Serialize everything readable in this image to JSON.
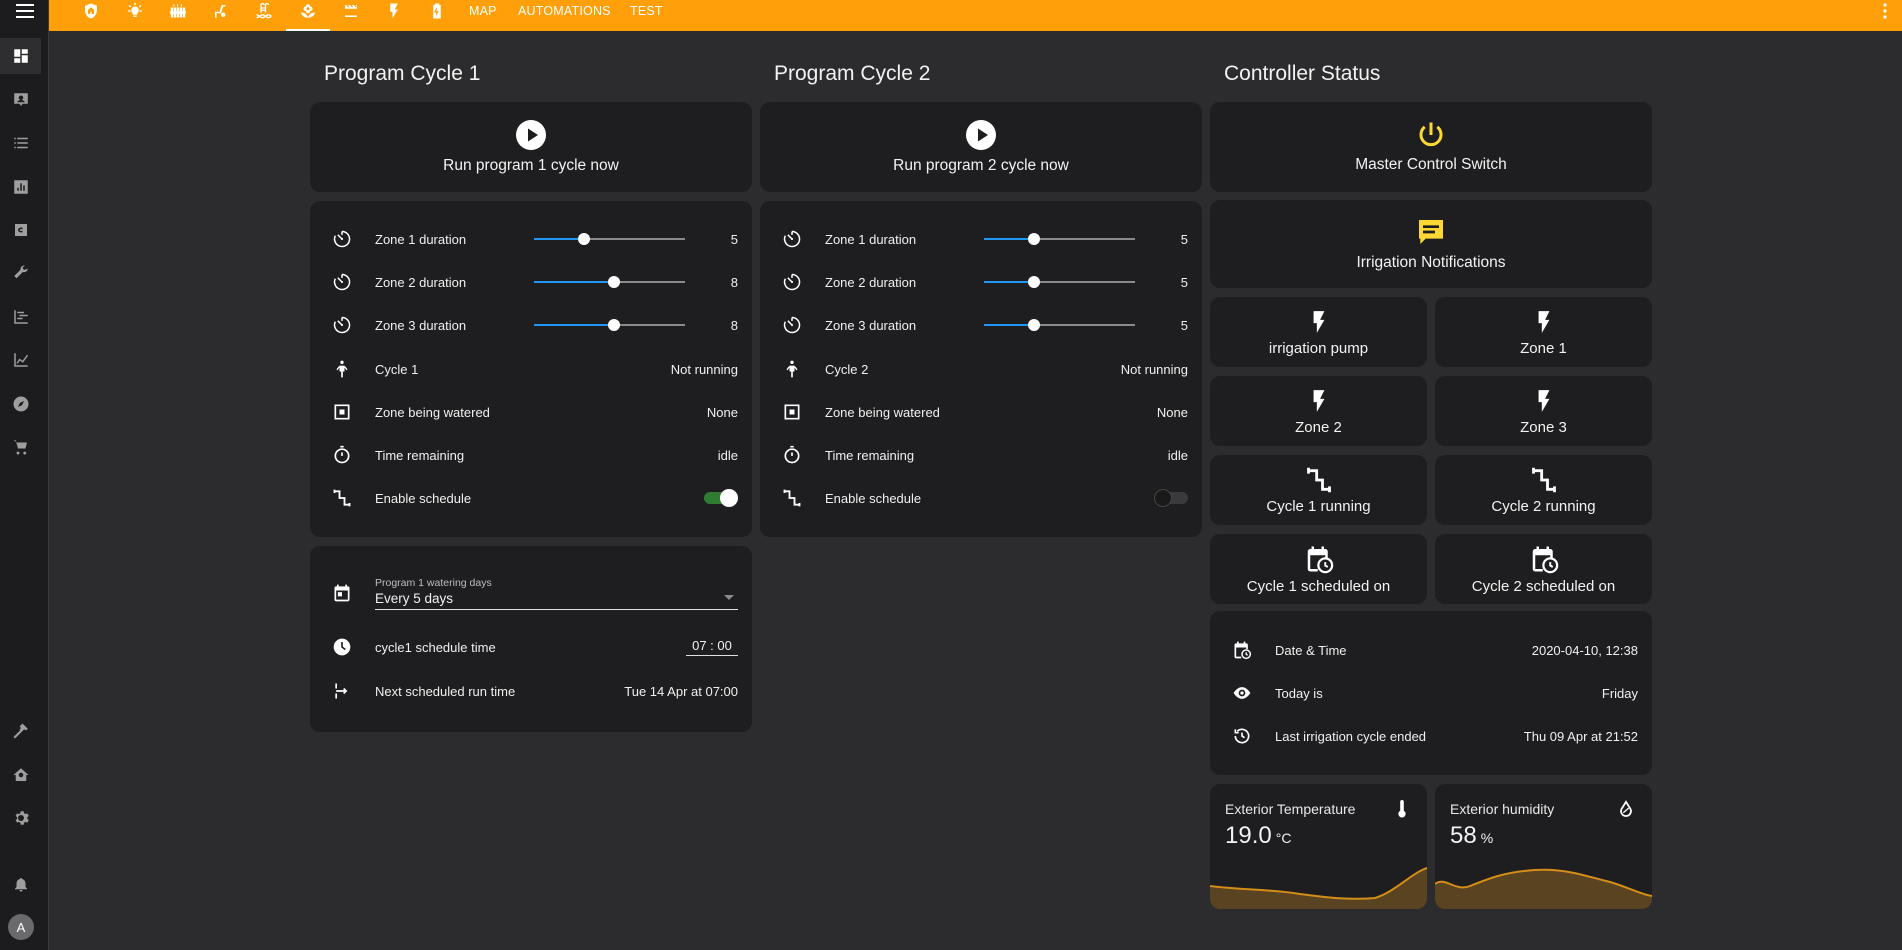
{
  "header": {
    "tabs": [
      "MAP",
      "AUTOMATIONS",
      "TEST"
    ],
    "icons": [
      "shield-home-icon",
      "lightbulb-icon",
      "radiator-icon",
      "robot-vacuum-icon",
      "pool-icon",
      "flower-icon",
      "movie-icon",
      "flash-icon",
      "battery-charging-icon"
    ]
  },
  "sidebar": {
    "icons": [
      "dashboard-icon",
      "account-box-icon",
      "list-icon",
      "chart-box-icon",
      "calendar-c-icon",
      "wrench-icon",
      "tree-icon",
      "chart-line-icon",
      "compass-icon",
      "cart-icon",
      "hammer-icon",
      "home-automation-icon",
      "settings-icon",
      "bell-icon"
    ],
    "avatar": "A"
  },
  "columns": {
    "c1": {
      "title": "Program Cycle 1",
      "run_label": "Run program 1 cycle now",
      "rows": [
        {
          "name": "Zone 1 duration",
          "value": "5",
          "pct": 0.33
        },
        {
          "name": "Zone 2 duration",
          "value": "8",
          "pct": 0.53
        },
        {
          "name": "Zone 3 duration",
          "value": "8",
          "pct": 0.53
        },
        {
          "name": "Cycle 1",
          "value": "Not running"
        },
        {
          "name": "Zone being watered",
          "value": "None"
        },
        {
          "name": "Time remaining",
          "value": "idle"
        },
        {
          "name": "Enable schedule",
          "on": true
        }
      ],
      "days_label": "Program 1 watering days",
      "days_value": "Every 5 days",
      "time_label": "cycle1 schedule time",
      "time_value": "07 : 00",
      "next_label": "Next scheduled run time",
      "next_value": "Tue 14 Apr at 07:00"
    },
    "c2": {
      "title": "Program Cycle 2",
      "run_label": "Run program 2 cycle now",
      "rows": [
        {
          "name": "Zone 1 duration",
          "value": "5",
          "pct": 0.33
        },
        {
          "name": "Zone 2 duration",
          "value": "5",
          "pct": 0.33
        },
        {
          "name": "Zone 3 duration",
          "value": "5",
          "pct": 0.33
        },
        {
          "name": "Cycle 2",
          "value": "Not running"
        },
        {
          "name": "Zone being watered",
          "value": "None"
        },
        {
          "name": "Time remaining",
          "value": "idle"
        },
        {
          "name": "Enable schedule",
          "on": false
        }
      ]
    },
    "c3": {
      "title": "Controller Status",
      "master_label": "Master Control Switch",
      "notif_label": "Irrigation Notifications",
      "grid": [
        "irrigation pump",
        "Zone 1",
        "Zone 2",
        "Zone 3",
        "Cycle 1 running",
        "Cycle 2 running",
        "Cycle 1 scheduled on",
        "Cycle 2 scheduled on"
      ],
      "info": [
        {
          "name": "Date & Time",
          "value": "2020-04-10, 12:38"
        },
        {
          "name": "Today is",
          "value": "Friday"
        },
        {
          "name": "Last irrigation cycle ended",
          "value": "Thu 09 Apr at 21:52"
        }
      ],
      "temp": {
        "title": "Exterior Temperature",
        "value": "19.0",
        "unit": "°C"
      },
      "hum": {
        "title": "Exterior humidity",
        "value": "58",
        "unit": "%"
      }
    }
  },
  "colors": {
    "accent": "#ff9f0a",
    "gold": "#fdd835",
    "switch_on": "#2e7d32",
    "slider": "#2196f3"
  }
}
